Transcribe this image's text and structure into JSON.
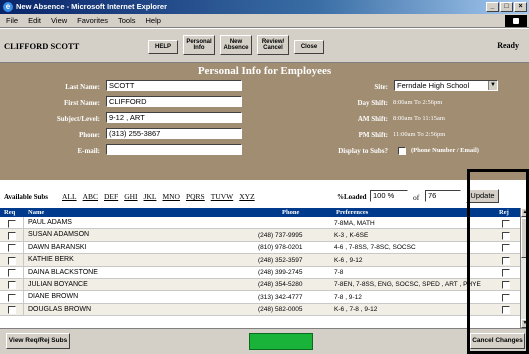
{
  "window": {
    "title": "New Absence - Microsoft Internet Explorer",
    "controls": [
      "_",
      "□",
      "×"
    ]
  },
  "menu": [
    "File",
    "Edit",
    "View",
    "Favorites",
    "Tools",
    "Help"
  ],
  "toolbar": {
    "user_name": "CLIFFORD SCOTT",
    "status": "Ready",
    "help_label": "HELP",
    "personal_info_label": "Personal Info",
    "new_absence_label": "New Absence",
    "review_cancel_label": "Review/ Cancel",
    "close_label": "Close"
  },
  "personal": {
    "title": "Personal Info for Employees",
    "fields": {
      "last_name_label": "Last Name:",
      "last_name": "SCOTT",
      "first_name_label": "First Name:",
      "first_name": "CLIFFORD",
      "subject_label": "Subject/Level:",
      "subject": "9-12 , ART",
      "phone_label": "Phone:",
      "phone": "(313) 255-3867",
      "email_label": "E-mail:",
      "email": ""
    },
    "site_label": "Site:",
    "site": "Ferndale High School",
    "day_shift_label": "Day Shift:",
    "day_shift": "8:00am To 2:56pm",
    "am_shift_label": "AM Shift:",
    "am_shift": "8:00am To 11:15am",
    "pm_shift_label": "PM Shift:",
    "pm_shift": "11:00am To 2:56pm",
    "display_label": "Display to Subs?",
    "display_option": "(Phone Number / Email)"
  },
  "subs": {
    "available_label": "Available Subs",
    "letters": [
      "ALL",
      "ABC",
      "DEF",
      "GHI",
      "JKL",
      "MNO",
      "PQRS",
      "TUVW",
      "XYZ"
    ],
    "loaded_label": "%Loaded",
    "loaded_value": "100 %",
    "of_label": "of",
    "total": "76",
    "update_label": "Update"
  },
  "table": {
    "columns": [
      "Req",
      "Name",
      "Phone",
      "Preferences",
      "Rej"
    ],
    "rows": [
      {
        "name": "PAUL ADAMS",
        "phone": "",
        "pref": "7-8MA, MATH"
      },
      {
        "name": "SUSAN ADAMSON",
        "phone": "(248) 737-9995",
        "pref": "K-3 , K-6SE"
      },
      {
        "name": "DAWN BARANSKI",
        "phone": "(810) 978-0201",
        "pref": "4-6 , 7-8SS, 7-8SC, SOCSC"
      },
      {
        "name": "KATHIE BERK",
        "phone": "(248) 352-3597",
        "pref": "K-6 , 9-12"
      },
      {
        "name": "DAINA BLACKSTONE",
        "phone": "(248) 399-2745",
        "pref": "7-8"
      },
      {
        "name": "JULIAN BOYANCE",
        "phone": "(248) 354-5280",
        "pref": "7-8EN, 7-8SS, ENG, SOCSC, SPED , ART , PHYE"
      },
      {
        "name": "DIANE BROWN",
        "phone": "(313) 342-4777",
        "pref": "7-8 , 9-12"
      },
      {
        "name": "DOUGLAS BROWN",
        "phone": "(248) 582-0005",
        "pref": "K-6 , 7-8 , 9-12"
      }
    ]
  },
  "footer": {
    "view_label": "View Req/Rej Subs",
    "cancel_changes_label": "Cancel Changes"
  },
  "colors": {
    "panel": "#a08d72",
    "table_header": "#003a8c",
    "accent_green": "#19b33a"
  }
}
